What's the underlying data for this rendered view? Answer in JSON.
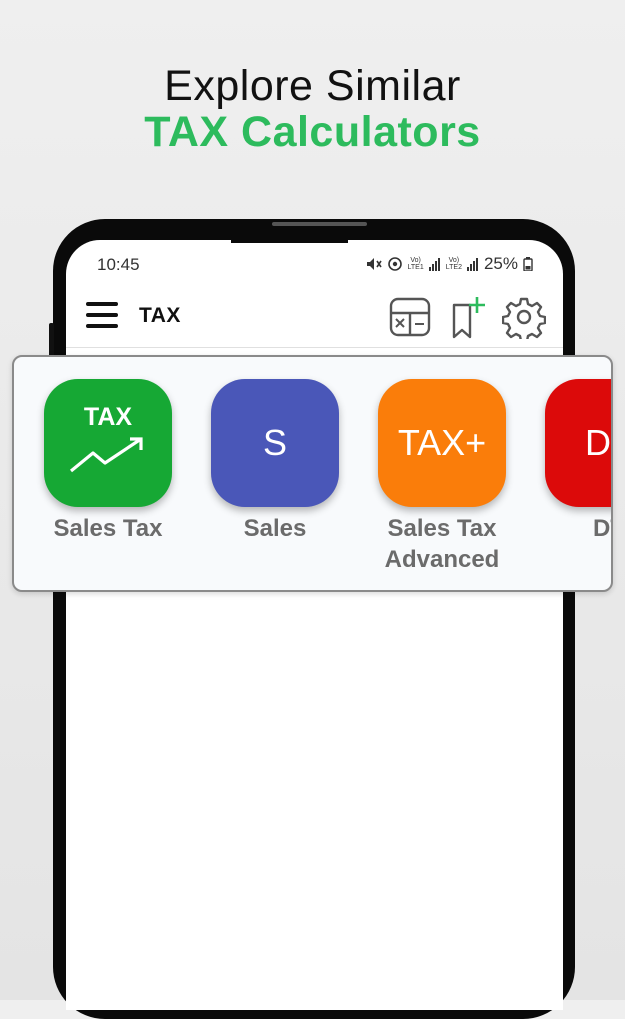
{
  "promo": {
    "line1": "Explore Similar",
    "line2": "TAX Calculators"
  },
  "status_bar": {
    "time": "10:45",
    "sim1_top": "Vo)",
    "sim1_bottom": "LTE1",
    "sim2_top": "Vo)",
    "sim2_bottom": "LTE2",
    "battery": "25%",
    "icons": [
      "mute-icon",
      "hotspot-icon",
      "signal-icon",
      "signal-icon",
      "battery-icon"
    ]
  },
  "app_bar": {
    "title": "TAX",
    "icons": [
      "menu-icon",
      "calculator-icon",
      "bookmark-add-icon",
      "settings-icon"
    ]
  },
  "apps": [
    {
      "icon_text": "TAX",
      "label": "Sales Tax",
      "color": "#16a834"
    },
    {
      "icon_text": "S",
      "label": "Sales",
      "color": "#4a57b8"
    },
    {
      "icon_text": "TAX+",
      "label": "Sales Tax Advanced",
      "color": "#fa7d0a"
    },
    {
      "icon_text": "DT",
      "label": "DT",
      "color": "#dc0a0a"
    }
  ],
  "colors": {
    "accent_green": "#2dbb5d",
    "tile_green": "#16a834",
    "tile_blue": "#4a57b8",
    "tile_orange": "#fa7d0a",
    "tile_red": "#dc0a0a"
  }
}
